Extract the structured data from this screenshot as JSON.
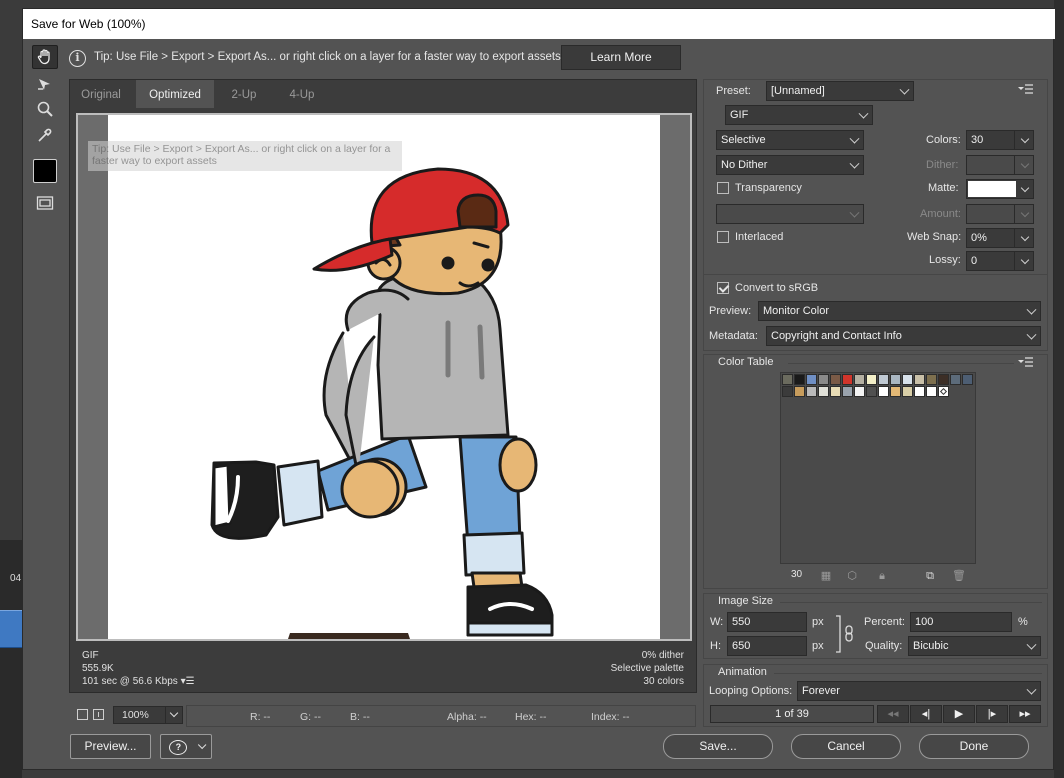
{
  "window": {
    "title": "Save for Web (100%)"
  },
  "background": {
    "timeline_label": "04"
  },
  "tip": {
    "text": "Tip: Use File > Export > Export As...  or right click on a layer for a faster way to export assets",
    "learn_more": "Learn More",
    "ghost_text": "Tip: Use File > Export > Export As...  or right click on a layer for a faster way to export assets"
  },
  "tabs": [
    {
      "label": "Original",
      "active": false
    },
    {
      "label": "Optimized",
      "active": true
    },
    {
      "label": "2-Up",
      "active": false
    },
    {
      "label": "4-Up",
      "active": false
    }
  ],
  "preview_info": {
    "format": "GIF",
    "size": "555.9K",
    "time": "101 sec @ 56.6 Kbps",
    "dither": "0% dither",
    "palette": "Selective palette",
    "colors": "30 colors"
  },
  "status": {
    "zoom": "100%",
    "r": "R: --",
    "g": "G: --",
    "b": "B: --",
    "alpha": "Alpha: --",
    "hex": "Hex: --",
    "index": "Index: --"
  },
  "buttons": {
    "preview": "Preview...",
    "save": "Save...",
    "cancel": "Cancel",
    "done": "Done"
  },
  "settings": {
    "preset_label": "Preset:",
    "preset_value": "[Unnamed]",
    "format": "GIF",
    "reduction": "Selective",
    "dither_algo": "No Dither",
    "colors_label": "Colors:",
    "colors_value": "30",
    "dither_label": "Dither:",
    "dither_value": "",
    "matte_label": "Matte:",
    "matte_color": "#ffffff",
    "transparency_label": "Transparency",
    "transparency_checked": false,
    "amount_label": "Amount:",
    "amount_value": "",
    "interlaced_label": "Interlaced",
    "interlaced_checked": false,
    "websnap_label": "Web Snap:",
    "websnap_value": "0%",
    "lossy_label": "Lossy:",
    "lossy_value": "0",
    "convert_srgb_label": "Convert to sRGB",
    "convert_srgb_checked": true,
    "preview_label": "Preview:",
    "preview_value": "Monitor Color",
    "metadata_label": "Metadata:",
    "metadata_value": "Copyright and Contact Info"
  },
  "color_table": {
    "title": "Color Table",
    "count": "30",
    "swatches": [
      "#6b6b5e",
      "#1a1a1a",
      "#6f8fc4",
      "#8a8a8a",
      "#7a5a46",
      "#d1352b",
      "#b5b0a2",
      "#f3efc8",
      "#bfc9d3",
      "#a9b6c1",
      "#d7e1ea",
      "#c9c0a8",
      "#7d6f4e",
      "#3c2e26",
      "#5c6b7a",
      "#4d5e73",
      "#3b3b3b",
      "#c79c5c",
      "#b9b9b9",
      "#e0e0d8",
      "#e9ddb6",
      "#9aa3ad",
      "#f3f3f3",
      "#505050",
      "#ffffff",
      "#e4b976",
      "#d9cfa8",
      "#ffffff",
      "#ffffff",
      "#ffffff"
    ]
  },
  "image_size": {
    "title": "Image Size",
    "w_label": "W:",
    "w_value": "550",
    "w_unit": "px",
    "h_label": "H:",
    "h_value": "650",
    "h_unit": "px",
    "percent_label": "Percent:",
    "percent_value": "100",
    "percent_unit": "%",
    "quality_label": "Quality:",
    "quality_value": "Bicubic"
  },
  "animation": {
    "title": "Animation",
    "looping_label": "Looping Options:",
    "looping_value": "Forever",
    "frame": "1 of 39"
  },
  "colors": {
    "accent_white": "#ffffff",
    "panel": "#535353"
  }
}
